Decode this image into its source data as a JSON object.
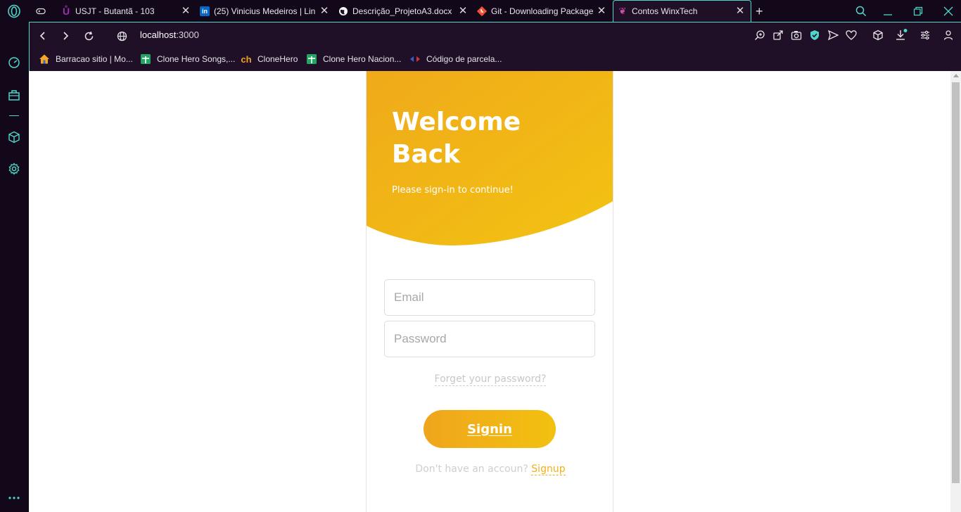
{
  "tabs": [
    {
      "title": "",
      "icon": "gamepad-icon"
    },
    {
      "title": "USJT - Butantã - 103",
      "icon": "usjt-logo-icon"
    },
    {
      "title": "(25) Vinicius Medeiros | Lin",
      "icon": "linkedin-icon"
    },
    {
      "title": "Descrição_ProjetoA3.docx",
      "icon": "globe-icon"
    },
    {
      "title": "Git - Downloading Package",
      "icon": "git-icon"
    },
    {
      "title": "Contos WinxTech",
      "icon": "winx-icon"
    }
  ],
  "address": {
    "host": "localhost",
    "port": ":3000"
  },
  "bookmarks": [
    {
      "label": "Barracao sitio | Mo...",
      "icon": "home-icon"
    },
    {
      "label": "Clone Hero Songs,...",
      "icon": "sheets-icon"
    },
    {
      "label": "CloneHero",
      "icon": "ch-icon"
    },
    {
      "label": "Clone Hero Nacion...",
      "icon": "sheets-icon"
    },
    {
      "label": "Código de parcela...",
      "icon": "code-icon"
    }
  ],
  "login": {
    "title": "Welcome Back",
    "subtitle": "Please sign-in to continue!",
    "email_placeholder": "Email",
    "password_placeholder": "Password",
    "forgot_label": "Forget your password?",
    "signin_label": "Signin",
    "no_account_text": "Don't have an accoun?",
    "signup_label": "Signup"
  },
  "colors": {
    "accent": "#4fd6c8",
    "brand_yellow": "#f0b114",
    "chrome_bg": "#1f1028"
  }
}
